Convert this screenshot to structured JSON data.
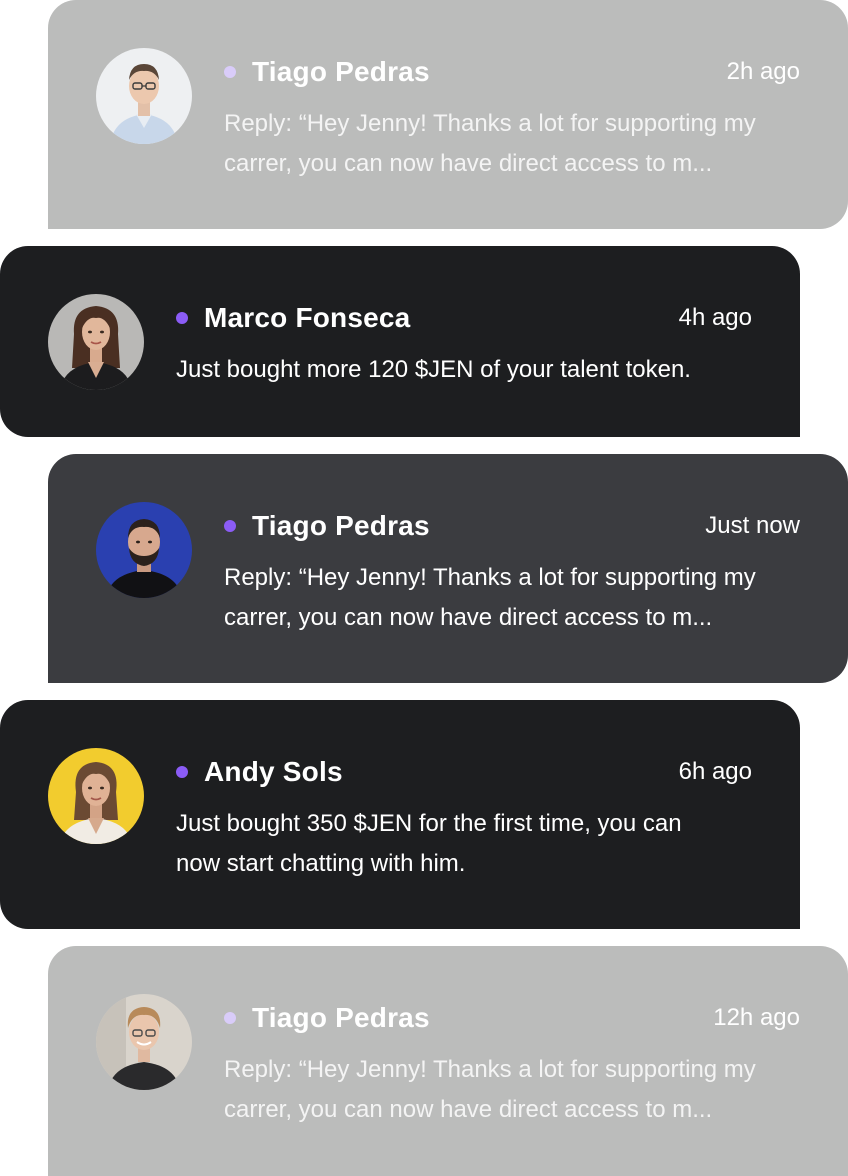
{
  "notifications": [
    {
      "name": "Tiago Pedras",
      "time": "2h ago",
      "message_lines": [
        "Reply: “Hey Jenny! Thanks a lot for supporting my",
        "carrer, you can now have direct access to m..."
      ],
      "style": "muted",
      "avatar_bg": "#eef0f2"
    },
    {
      "name": "Marco Fonseca",
      "time": "4h ago",
      "message_lines": [
        "Just bought more 120 $JEN of your talent token."
      ],
      "style": "black",
      "avatar_bg": "#b9b8b6"
    },
    {
      "name": "Tiago Pedras",
      "time": "Just now",
      "message_lines": [
        "Reply: “Hey Jenny! Thanks a lot for supporting my",
        "carrer, you can now have direct access to m..."
      ],
      "style": "slate",
      "avatar_bg": "#2a40b0"
    },
    {
      "name": "Andy Sols",
      "time": "6h ago",
      "message_lines": [
        "Just bought 350 $JEN for the first time, you can",
        "now start chatting with him."
      ],
      "style": "black",
      "avatar_bg": "#f2cc2e"
    },
    {
      "name": "Tiago Pedras",
      "time": "12h ago",
      "message_lines": [
        "Reply: “Hey Jenny! Thanks a lot for supporting my",
        "carrer, you can now have direct access to m..."
      ],
      "style": "muted",
      "avatar_bg": "#d9d4cc"
    }
  ],
  "colors": {
    "accent_dot": "#8b5cf6",
    "accent_dot_muted": "#d9ccf9",
    "card_dark": "#1d1e20",
    "card_slate": "#3b3c40",
    "card_muted": "#bbbcbb"
  }
}
